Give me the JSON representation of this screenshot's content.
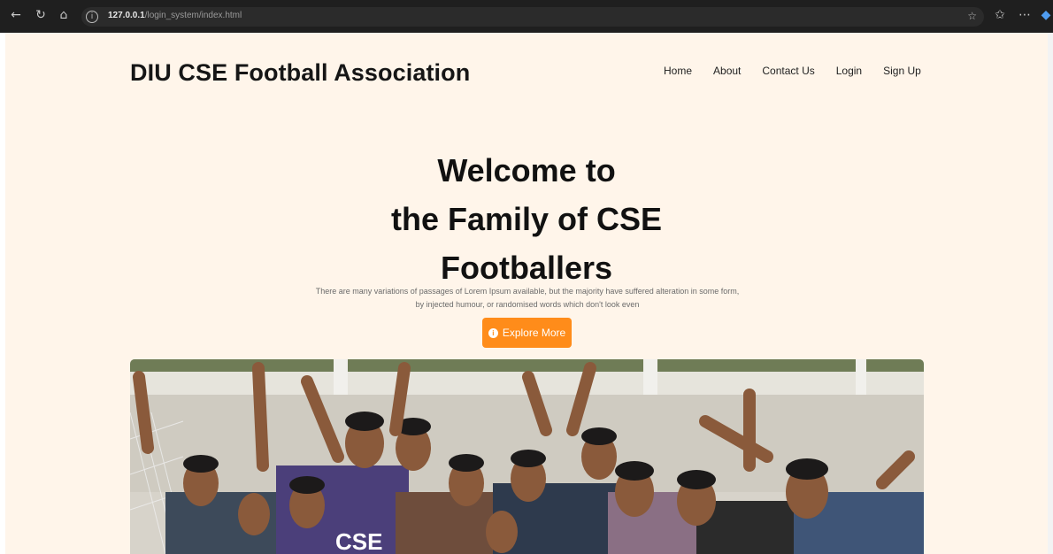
{
  "browser": {
    "url_host": "127.0.0.1",
    "url_path": "/login_system/index.html"
  },
  "site": {
    "brand": "DIU CSE Football Association",
    "nav": [
      "Home",
      "About",
      "Contact Us",
      "Login",
      "Sign Up"
    ]
  },
  "hero": {
    "title_lines": [
      "Welcome to",
      "the Family of CSE",
      "Footballers"
    ],
    "subtitle": "There are many variations of passages of Lorem Ipsum available, but the majority have suffered alteration in some form, by injected humour, or randomised words which don't look even",
    "cta_label": "Explore More",
    "photo_jersey_text": "CSE"
  },
  "colors": {
    "page_bg": "#fff5ea",
    "accent": "#ff8c1a"
  }
}
